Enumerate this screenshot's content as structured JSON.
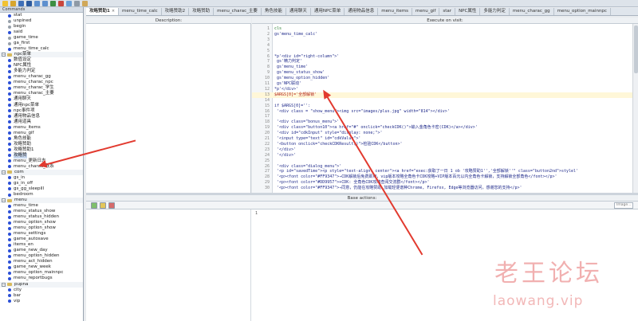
{
  "toolbar": {
    "buttons": [
      "run-icon",
      "save-icon",
      "save-all-icon",
      "undo-icon",
      "redo-icon",
      "play-icon",
      "stop-icon",
      "refresh-icon",
      "settings-icon",
      "help-icon",
      "info-icon"
    ]
  },
  "left_panel": {
    "header": "Commands",
    "items": [
      {
        "label": "stat",
        "type": "item",
        "color": "blue"
      },
      {
        "label": "unpined",
        "type": "item",
        "color": "gray"
      },
      {
        "label": "begin",
        "type": "item",
        "color": "gray"
      },
      {
        "label": "said",
        "type": "item",
        "color": "blue"
      },
      {
        "label": "game_time",
        "type": "item",
        "color": "gray"
      },
      {
        "label": "ga_first",
        "type": "item",
        "color": "gray"
      },
      {
        "label": "menu_time_calc",
        "type": "item",
        "color": "blue"
      },
      {
        "label": "npc菜单",
        "type": "group"
      },
      {
        "label": "数值设定",
        "type": "item",
        "color": "blue"
      },
      {
        "label": "NPC属性",
        "type": "item",
        "color": "blue"
      },
      {
        "label": "多能力判定",
        "type": "item",
        "color": "blue"
      },
      {
        "label": "menu_charac_gg",
        "type": "item",
        "color": "blue"
      },
      {
        "label": "menu_charac_npc",
        "type": "item",
        "color": "blue"
      },
      {
        "label": "menu_charac_学生",
        "type": "item",
        "color": "blue"
      },
      {
        "label": "menu_charac_主要",
        "type": "item",
        "color": "blue"
      },
      {
        "label": "通用聊天",
        "type": "item",
        "color": "blue"
      },
      {
        "label": "通用npc菜单",
        "type": "item",
        "color": "blue"
      },
      {
        "label": "npc事件项",
        "type": "item",
        "color": "blue"
      },
      {
        "label": "通用物品信息",
        "type": "item",
        "color": "blue"
      },
      {
        "label": "通用道具",
        "type": "item",
        "color": "blue"
      },
      {
        "label": "menu_items",
        "type": "item",
        "color": "blue"
      },
      {
        "label": "menu_gif",
        "type": "item",
        "color": "blue"
      },
      {
        "label": "角色技能",
        "type": "item",
        "color": "blue"
      },
      {
        "label": "攻略赞助",
        "type": "item",
        "color": "blue"
      },
      {
        "label": "攻略赞助1",
        "type": "item",
        "color": "blue"
      },
      {
        "label": "攻略赞",
        "type": "item",
        "color": "blue",
        "selected": true
      },
      {
        "label": "menu_更新日志",
        "type": "item",
        "color": "blue"
      },
      {
        "label": "menu_charac_联系",
        "type": "item",
        "color": "blue"
      },
      {
        "label": "com",
        "type": "group"
      },
      {
        "label": "gs_in",
        "type": "item",
        "color": "blue"
      },
      {
        "label": "gs_in_off",
        "type": "item",
        "color": "blue"
      },
      {
        "label": "gs_gg_sleepill",
        "type": "item",
        "color": "blue"
      },
      {
        "label": "bedroom",
        "type": "item",
        "color": "blue"
      },
      {
        "label": "menu",
        "type": "group"
      },
      {
        "label": "menu_time",
        "type": "item",
        "color": "blue"
      },
      {
        "label": "menu_status_show",
        "type": "item",
        "color": "blue"
      },
      {
        "label": "menu_status_hidden",
        "type": "item",
        "color": "blue"
      },
      {
        "label": "menu_option_show",
        "type": "item",
        "color": "blue"
      },
      {
        "label": "menu_option_show",
        "type": "item",
        "color": "blue"
      },
      {
        "label": "menu_settings",
        "type": "item",
        "color": "blue"
      },
      {
        "label": "game_autosave",
        "type": "item",
        "color": "blue"
      },
      {
        "label": "items_en",
        "type": "item",
        "color": "blue"
      },
      {
        "label": "game_new_day",
        "type": "item",
        "color": "blue"
      },
      {
        "label": "menu_option_hidden",
        "type": "item",
        "color": "blue"
      },
      {
        "label": "menu_act_hidden",
        "type": "item",
        "color": "blue"
      },
      {
        "label": "game_new_week",
        "type": "item",
        "color": "blue"
      },
      {
        "label": "menu_option_mainnpc",
        "type": "item",
        "color": "blue"
      },
      {
        "label": "menu_reportbugs",
        "type": "item",
        "color": "blue"
      },
      {
        "label": "pupna",
        "type": "group"
      },
      {
        "label": "city",
        "type": "item",
        "color": "blue"
      },
      {
        "label": "bar",
        "type": "item",
        "color": "blue"
      },
      {
        "label": "vip",
        "type": "item",
        "color": "blue"
      }
    ]
  },
  "tabs": [
    {
      "label": "攻略赞助1",
      "active": true
    },
    {
      "label": "menu_time_calc"
    },
    {
      "label": "攻略赞助2"
    },
    {
      "label": "攻略赞助"
    },
    {
      "label": "menu_charac_主要"
    },
    {
      "label": "角色技能"
    },
    {
      "label": "通用聊天"
    },
    {
      "label": "通用NPC菜单"
    },
    {
      "label": "通用物品信息"
    },
    {
      "label": "menu_items"
    },
    {
      "label": "menu_gif"
    },
    {
      "label": "star"
    },
    {
      "label": "NPC属性"
    },
    {
      "label": "多能力判定"
    },
    {
      "label": "menu_charac_gg"
    },
    {
      "label": "menu_option_mainnpc"
    }
  ],
  "description_header": "Description:",
  "execute_header": "Execute on visit:",
  "code_lines": [
    {
      "n": "1",
      "text": "cls",
      "cls": "green"
    },
    {
      "n": "2",
      "text": "gs'menu_time_calc'",
      "cls": ""
    },
    {
      "n": "3",
      "text": "",
      "cls": ""
    },
    {
      "n": "4",
      "text": "",
      "cls": ""
    },
    {
      "n": "5",
      "text": "",
      "cls": ""
    },
    {
      "n": "6",
      "text": "*p'<div id=\"right-column\">'",
      "cls": ""
    },
    {
      "n": "7",
      "text": "    gs'精力判定'",
      "cls": ""
    },
    {
      "n": "8",
      "text": "    gs'menu_time'",
      "cls": ""
    },
    {
      "n": "9",
      "text": "    gs'menu_status_show'",
      "cls": ""
    },
    {
      "n": "10",
      "text": "    gs'menu_option_hidden'",
      "cls": ""
    },
    {
      "n": "11",
      "text": "    gs'NPC联动'",
      "cls": ""
    },
    {
      "n": "12",
      "text": "*p'</div>'",
      "cls": ""
    },
    {
      "n": "13",
      "text": "$ARGS[0]='全部解锁'",
      "cls": "red"
    },
    {
      "n": "14",
      "text": "",
      "cls": ""
    },
    {
      "n": "15",
      "text": "if $ARGS[0]='':",
      "cls": ""
    },
    {
      "n": "16",
      "text": "  '<div class = \"show_menu\"><img src=\"images/plus.jpg\" width=\"814\"></div>'",
      "cls": ""
    },
    {
      "n": "17",
      "text": "",
      "cls": ""
    },
    {
      "n": "18",
      "text": "  '<div class=\"bonus_menu\">'",
      "cls": ""
    },
    {
      "n": "19",
      "text": "     '<div class=\"button10\"><a href=\"#\" onclick=\"checkCDK()\">输入金角色卡密(CDK)</a></div>'",
      "cls": ""
    },
    {
      "n": "20",
      "text": "     '<div id=\"cdkInput\" style=\"display: none;\">'",
      "cls": ""
    },
    {
      "n": "21",
      "text": "        '<input type=\"text\" id=\"cdkValue\">'",
      "cls": ""
    },
    {
      "n": "22",
      "text": "        '<button onclick=\"checkCDKResult()\">检验CDK</button>'",
      "cls": ""
    },
    {
      "n": "23",
      "text": "     '</div>'",
      "cls": ""
    },
    {
      "n": "24",
      "text": "  '</div>'",
      "cls": ""
    },
    {
      "n": "25",
      "text": "",
      "cls": ""
    },
    {
      "n": "26",
      "text": "  '<div class=\"dialog_menu\">'",
      "cls": ""
    },
    {
      "n": "27",
      "text": "     '<p id=\"savedTime\"><p style=\"text-align: center\"><a href=\"exec:获取了一日 1 ob  '攻略赞助1'','全部解锁''\" class=\"button2nd\">stylel'",
      "cls": ""
    },
    {
      "n": "28",
      "text": "     '<p><font color=\"#FF9347\">→CDK解锁后免费即用，vip版本攻略全角色卡CDK攻略+VIP版本百元以内全角色卡解锁，支持解锁全部角色</font></p>'",
      "cls": ""
    },
    {
      "n": "29",
      "text": "     '<p><font color=\"#DD9957\">+CDK: 全角色CDK攻略查阅交流群</font></p>'",
      "cls": ""
    },
    {
      "n": "30",
      "text": "     '<p><font color=\"#FF9347\">→同意，仍能在攻略赞助 加载轻便谱种Chrome, Firefox, Edge等浏览器访问，感谢您的支持</p>'",
      "cls": ""
    }
  ],
  "base_actions_header": "Base actions:",
  "base_toolbar": {
    "icons": [
      "add-action-icon",
      "edit-action-icon",
      "delete-action-icon"
    ],
    "select_placeholder": "Image..."
  },
  "base_editor": {
    "line_number": "1"
  },
  "watermark": {
    "cn": "老王论坛",
    "en": "laowang.vip"
  },
  "colors": {
    "accent": "#2b4fd6",
    "arrow": "#e23a2f",
    "watermark": "#e57070"
  }
}
